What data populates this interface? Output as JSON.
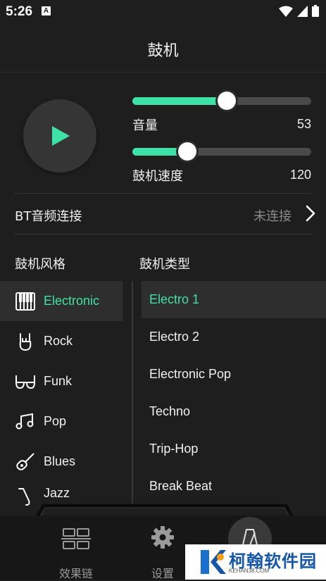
{
  "status_bar": {
    "time": "5:26",
    "badge": "A"
  },
  "header": {
    "title": "鼓机"
  },
  "controls": {
    "volume": {
      "label": "音量",
      "value": "53",
      "level": 0.53
    },
    "tempo": {
      "label": "鼓机速度",
      "value": "120",
      "level": 0.31
    }
  },
  "bt": {
    "label": "BT音频连接",
    "status": "未连接"
  },
  "styles": {
    "heading": "鼓机风格",
    "items": [
      {
        "label": "Electronic",
        "icon": "keyboard-icon",
        "active": true
      },
      {
        "label": "Rock",
        "icon": "rock-hand-icon"
      },
      {
        "label": "Funk",
        "icon": "funk-glasses-icon"
      },
      {
        "label": "Pop",
        "icon": "music-notes-icon"
      },
      {
        "label": "Blues",
        "icon": "guitar-icon"
      },
      {
        "label": "Jazz",
        "icon": "saxophone-icon"
      }
    ]
  },
  "types": {
    "heading": "鼓机类型",
    "items": [
      {
        "label": "Electro 1",
        "active": true
      },
      {
        "label": "Electro 2"
      },
      {
        "label": "Electronic Pop"
      },
      {
        "label": "Techno"
      },
      {
        "label": "Trip-Hop"
      },
      {
        "label": "Break Beat"
      }
    ]
  },
  "bottom_nav": {
    "effects_label": "效果链",
    "settings_label": "设置"
  },
  "watermark": {
    "title": "柯翰软件园",
    "subtitle": "KEHAN38.COM"
  },
  "colors": {
    "accent": "#3ee2a8",
    "background": "#1e1e1e",
    "panel": "#2e2e2e"
  }
}
